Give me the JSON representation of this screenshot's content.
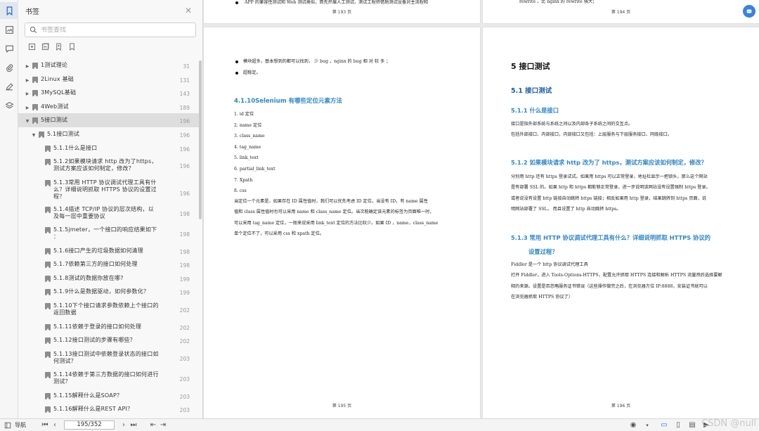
{
  "rail": {
    "icons": [
      "bookmark-icon",
      "thumbnail-icon",
      "comment-icon",
      "attachment-icon",
      "signature-icon",
      "layers-icon"
    ]
  },
  "bookmarks": {
    "title": "书签",
    "search_placeholder": "书签查找",
    "items": [
      {
        "label": "1测试理论",
        "page": "31",
        "level": 0,
        "arrow": "▶",
        "sel": false
      },
      {
        "label": "2Linux 基础",
        "page": "131",
        "level": 0,
        "arrow": "▶",
        "sel": false
      },
      {
        "label": "3MySQL基础",
        "page": "143",
        "level": 0,
        "arrow": "▶",
        "sel": false
      },
      {
        "label": "4Web测试",
        "page": "189",
        "level": 0,
        "arrow": "▶",
        "sel": false
      },
      {
        "label": "5接口测试",
        "page": "196",
        "level": 0,
        "arrow": "▼",
        "sel": true
      },
      {
        "label": "5.1接口测试",
        "page": "196",
        "level": 1,
        "arrow": "▼",
        "sel": false
      },
      {
        "label": "5.1.1什么是接口",
        "page": "196",
        "level": 2,
        "arrow": "",
        "sel": false
      },
      {
        "label": "5.1.2如果模块请求 http 改为了https，\n测试方案应该如何制定，修改？",
        "page": "196",
        "level": 2,
        "arrow": "",
        "sel": false
      },
      {
        "label": "5.1.3常用 HTTP 协议调试代理工具有什\n么？详细说明抓取 HTTPS 协议的设置过\n程？",
        "page": "196",
        "level": 2,
        "arrow": "",
        "sel": false
      },
      {
        "label": "5.1.4描述 TCP/IP 协议的层次结构，以\n及每一层中重要协议",
        "page": "198",
        "level": 2,
        "arrow": "",
        "sel": false
      },
      {
        "label": "5.1.5jmeter，一个接口的响应结果如下\n：",
        "page": "198",
        "level": 2,
        "arrow": "",
        "sel": false
      },
      {
        "label": "5.1.6接口产生的垃圾数据如何清理",
        "page": "198",
        "level": 2,
        "arrow": "",
        "sel": false
      },
      {
        "label": "5.1.7依赖第三方的接口如何处理",
        "page": "198",
        "level": 2,
        "arrow": "",
        "sel": false
      },
      {
        "label": "5.1.8测试的数据你放在哪?",
        "page": "199",
        "level": 2,
        "arrow": "",
        "sel": false
      },
      {
        "label": "5.1.9什么是数据驱动，如何参数化？",
        "page": "199",
        "level": 2,
        "arrow": "",
        "sel": false
      },
      {
        "label": "5.1.10下个接口请求参数依赖上个接口的\n返回数据",
        "page": "202",
        "level": 2,
        "arrow": "",
        "sel": false
      },
      {
        "label": "5.1.11依赖于登录的接口如何处理",
        "page": "202",
        "level": 2,
        "arrow": "",
        "sel": false
      },
      {
        "label": "5.1.12接口测试的步骤有哪些？",
        "page": "202",
        "level": 2,
        "arrow": "",
        "sel": false
      },
      {
        "label": "5.1.13接口测试中依赖登录状态的接口如\n何测试？",
        "page": "203",
        "level": 2,
        "arrow": "",
        "sel": false
      },
      {
        "label": "5.1.14依赖于第三方数据的接口如何进行\n测试？",
        "page": "203",
        "level": 2,
        "arrow": "",
        "sel": false
      },
      {
        "label": "5.1.15解释什么是SOAP？",
        "page": "203",
        "level": 2,
        "arrow": "",
        "sel": false
      },
      {
        "label": "5.1.16解释什么是REST API？",
        "page": "203",
        "level": 2,
        "arrow": "",
        "sel": false
      }
    ]
  },
  "top_left": {
    "line": "APP 的兼容性测试和 Web 测试类似，首先开展人工测试，测试工程师借助测试设备对主流程和",
    "page_label": "第 193 页"
  },
  "top_right": {
    "line": "rewrite ，比 nginx 的 rewrite 强大；",
    "page_label": "第 194 页"
  },
  "left_page": {
    "bullet1": "模块超多，基本想到的都可以找到，  少 bug ，nginx 的 bug 相 对 较 多 ；",
    "bullet2": "超稳定。",
    "heading": "4.1.10Selenium 有哪些定位元素方法",
    "list": [
      "1.  id 定位",
      "2.  name 定位",
      "3.  class_name",
      "4.  tag_name",
      "5.  link_text",
      "6.  partial_link_text",
      "7.  Xpath",
      "8.  css"
    ],
    "para": [
      "当定位一个元素是，如果存在 ID 属性值时，我们可以优先考虑 ID 定位，当没有 ID，有 name 属性",
      "值和 class 属性值时也可以采用 name 和 class_name 定位。当次能确定该元素的标签为页面唯一时，",
      "可以采用 tag_name 定位，一般来说采用 link_text 定位的方法比较少。如果 ID ，name，class_name",
      "单个定位不了，可以采用 css 和 xpath 定位。"
    ],
    "page_label": "第 195 页"
  },
  "right_page": {
    "h1": "5  接口测试",
    "h2": "5.1 接口测试",
    "h3a": "5.1.1  什么是接口",
    "p1a": "接口是指外部系统与系统之间以及内部各子系统之间的交互点。",
    "p1b": "包括外部接口、内部接口，内部接口又包括：上层服务与下层服务接口、同级接口。",
    "h3b": "5.1.2  如果模块请求  http  改为了 https，测试方案应该如何制定，修改？",
    "p2": [
      "分别用  http  还有  https  登录试试。如果用  https  可以正常登录，地址栏显示一把锁头，那么这个网站",
      "是有部署  SSL  的。如果  http  和  https  都能够正常登录，进一步说明该网站没有设置强制  https  登录。",
      "或者说没有设置  http  链接自动跳转  https  链接；相反如果用  http  登录，结果跳转到  https  页面，说",
      "明网站部署了  SSL，  而且设置了  http  自动跳转  https。"
    ],
    "h3c1": "5.1.3  常用  HTTP  协议调试代理工具有什么？详细说明抓取  HTTPS  协议的",
    "h3c2": "设置过程？",
    "p3": [
      "Fiddler  是一个  http  协议调试代理工具",
      "打开 Fiddler，进入 Tools-Options-HTTPS，配置允许抓取  HTTPS  连接和解析  HTTPS  流量然后选择要解",
      "释的来源。设置是否忽略服务证书错误（这些操作做完之后，在浏览器方位  IP:8888，安装证书就可以",
      "在浏览器抓取  HTTPS  协议了）"
    ],
    "page_label": "第 196 页"
  },
  "status": {
    "nav_label": "导航",
    "page_value": "195/352"
  },
  "watermark": "CSDN @null"
}
